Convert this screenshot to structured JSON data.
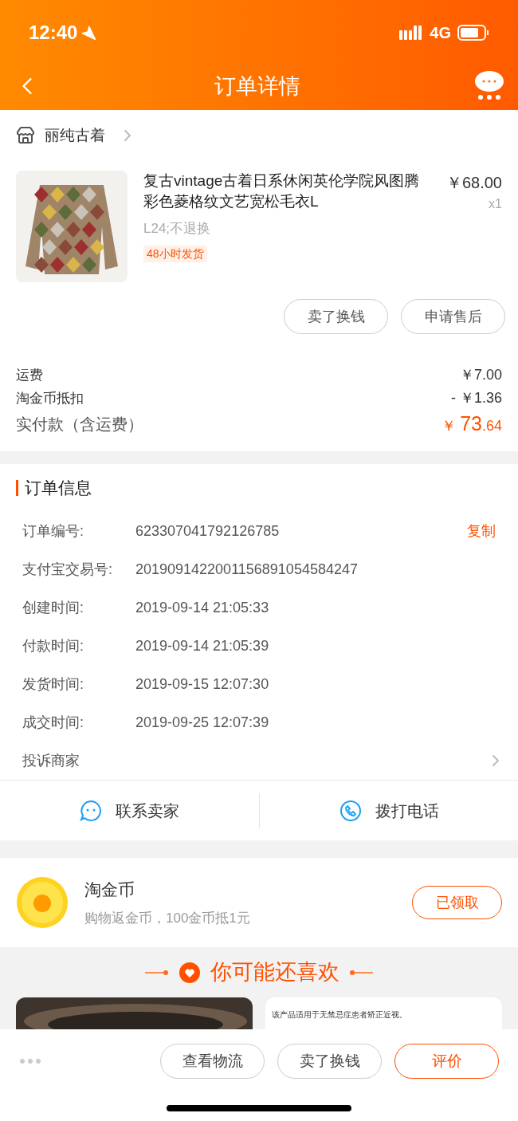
{
  "status_bar": {
    "time": "12:40",
    "network": "4G"
  },
  "nav": {
    "title": "订单详情"
  },
  "shop": {
    "name": "丽纯古着"
  },
  "product": {
    "title": "复古vintage古着日系休闲英伦学院风图腾彩色菱格纹文艺宽松毛衣L",
    "price": "￥68.00",
    "quantity": "x1",
    "spec": "L24;不退换",
    "tag": "48小时发货"
  },
  "item_actions": [
    "卖了换钱",
    "申请售后"
  ],
  "fees": [
    {
      "kind": "normal",
      "label": "运费",
      "value": "￥7.00"
    },
    {
      "kind": "normal",
      "label": "淘金币抵扣",
      "value": "- ￥1.36"
    },
    {
      "kind": "total",
      "label": "实付款（含运费）",
      "currency": "￥",
      "integer": "73",
      "decimal": ".64"
    }
  ],
  "order_info": {
    "title": "订单信息",
    "rows": [
      {
        "label": "订单编号:",
        "value": "623307041792126785",
        "action": "复制"
      },
      {
        "label": "支付宝交易号:",
        "value": "2019091422001156891054584247"
      },
      {
        "label": "创建时间:",
        "value": "2019-09-14 21:05:33"
      },
      {
        "label": "付款时间:",
        "value": "2019-09-14 21:05:39"
      },
      {
        "label": "发货时间:",
        "value": "2019-09-15 12:07:30"
      },
      {
        "label": "成交时间:",
        "value": "2019-09-25 12:07:39"
      }
    ],
    "complaint": "投诉商家"
  },
  "contact": [
    {
      "kind": "chat",
      "label": "联系卖家"
    },
    {
      "kind": "phone",
      "label": "拨打电话"
    }
  ],
  "coins": {
    "title": "淘金币",
    "subtitle": "购物返金币，100金币抵1元",
    "button": "已领取"
  },
  "recommend": {
    "title": "你可能还喜欢",
    "card_note": "该产品适用于无禁忌症患者矫正近视。"
  },
  "bottom_actions": [
    {
      "label": "查看物流",
      "primary": false
    },
    {
      "label": "卖了换钱",
      "primary": false
    },
    {
      "label": "评价",
      "primary": true
    }
  ]
}
